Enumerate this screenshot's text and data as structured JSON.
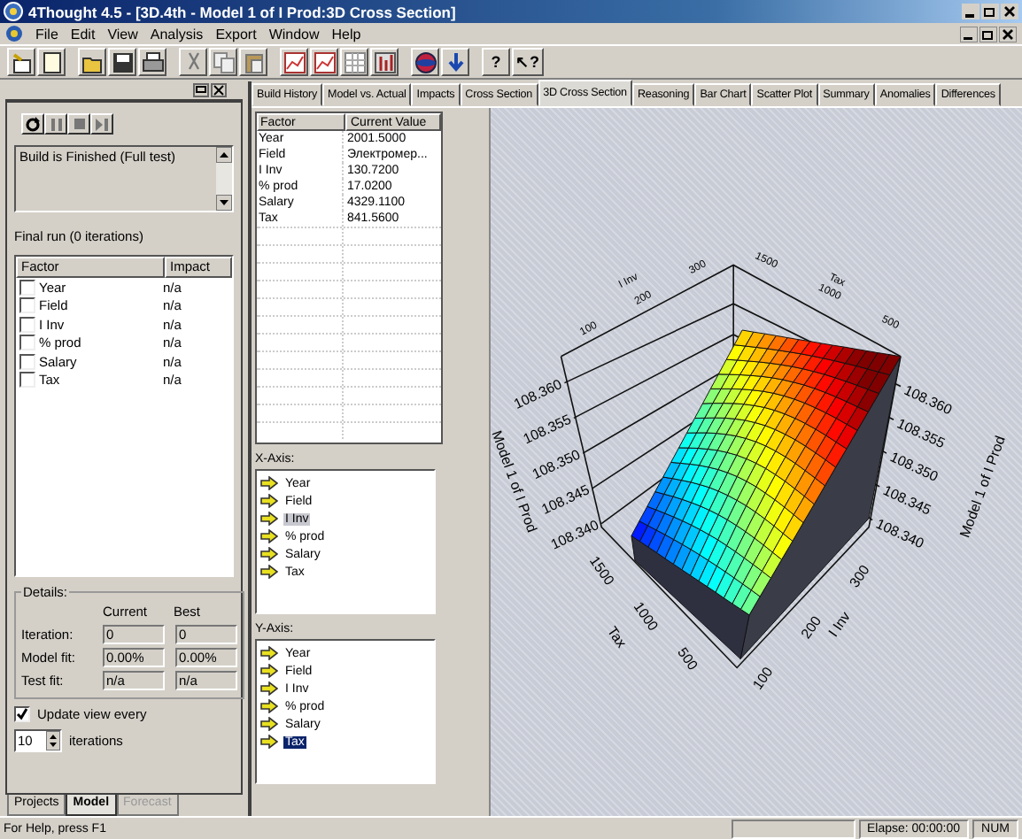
{
  "window": {
    "title": "4Thought 4.5 - [3D.4th - Model 1 of I Prod:3D Cross Section]"
  },
  "menu": [
    "File",
    "Edit",
    "View",
    "Analysis",
    "Export",
    "Window",
    "Help"
  ],
  "toolbar": [
    {
      "kind": "wizard"
    },
    {
      "kind": "new"
    },
    {
      "kind": "open"
    },
    {
      "kind": "save"
    },
    {
      "kind": "print"
    },
    {
      "kind": "cut"
    },
    {
      "kind": "copy"
    },
    {
      "kind": "paste"
    },
    {
      "kind": "chart"
    },
    {
      "kind": "chart"
    },
    {
      "kind": "grid"
    },
    {
      "kind": "table"
    },
    {
      "kind": "globe"
    },
    {
      "kind": "down"
    },
    {
      "kind": "help",
      "glyph": "?"
    },
    {
      "kind": "help",
      "glyph": "↖?"
    }
  ],
  "run_panel": {
    "status_text": "Build is Finished (Full test)",
    "final_run": "Final run (0 iterations)",
    "factor_table": {
      "columns": [
        "Factor",
        "Impact"
      ],
      "rows": [
        {
          "factor": "Year",
          "impact": "n/a",
          "checked": false
        },
        {
          "factor": "Field",
          "impact": "n/a",
          "checked": false
        },
        {
          "factor": "I Inv",
          "impact": "n/a",
          "checked": false
        },
        {
          "factor": "% prod",
          "impact": "n/a",
          "checked": false
        },
        {
          "factor": "Salary",
          "impact": "n/a",
          "checked": false
        },
        {
          "factor": "Tax",
          "impact": "n/a",
          "checked": false
        }
      ]
    },
    "details": {
      "title": "Details:",
      "columns": [
        "Current",
        "Best"
      ],
      "rows": [
        {
          "label": "Iteration:",
          "current": "0",
          "best": "0"
        },
        {
          "label": "Model fit:",
          "current": "0.00%",
          "best": "0.00%"
        },
        {
          "label": "Test fit:",
          "current": "n/a",
          "best": "n/a"
        }
      ]
    },
    "update_view": {
      "label": "Update view every",
      "checked": true
    },
    "iterations": {
      "value": "10",
      "label": "iterations"
    }
  },
  "panel_tabs": [
    {
      "label": "Projects",
      "selected": false,
      "disabled": false
    },
    {
      "label": "Model",
      "selected": true,
      "disabled": false
    },
    {
      "label": "Forecast",
      "selected": false,
      "disabled": true
    }
  ],
  "view_tabs": [
    {
      "label": "Build History",
      "selected": false
    },
    {
      "label": "Model vs. Actual",
      "selected": false
    },
    {
      "label": "Impacts",
      "selected": false
    },
    {
      "label": "Cross Section",
      "selected": false
    },
    {
      "label": "3D Cross Section",
      "selected": true
    },
    {
      "label": "Reasoning",
      "selected": false
    },
    {
      "label": "Bar Chart",
      "selected": false
    },
    {
      "label": "Scatter Plot",
      "selected": false
    },
    {
      "label": "Summary",
      "selected": false
    },
    {
      "label": "Anomalies",
      "selected": false
    },
    {
      "label": "Differences",
      "selected": false
    }
  ],
  "factor_values": {
    "columns": [
      "Factor",
      "Current Value"
    ],
    "rows": [
      [
        "Year",
        "2001.5000"
      ],
      [
        "Field",
        "Электромер..."
      ],
      [
        "I Inv",
        "130.7200"
      ],
      [
        "% prod",
        "17.0200"
      ],
      [
        "Salary",
        "4329.1100"
      ],
      [
        "Tax",
        "841.5600"
      ]
    ]
  },
  "x_axis": {
    "label": "X-Axis:",
    "items": [
      {
        "label": "Year",
        "selected": false
      },
      {
        "label": "Field",
        "selected": false
      },
      {
        "label": "I Inv",
        "selected": true
      },
      {
        "label": "% prod",
        "selected": false
      },
      {
        "label": "Salary",
        "selected": false
      },
      {
        "label": "Tax",
        "selected": false
      }
    ]
  },
  "y_axis": {
    "label": "Y-Axis:",
    "items": [
      {
        "label": "Year",
        "selected": false
      },
      {
        "label": "Field",
        "selected": false
      },
      {
        "label": "I Inv",
        "selected": false
      },
      {
        "label": "% prod",
        "selected": false
      },
      {
        "label": "Salary",
        "selected": false
      },
      {
        "label": "Tax",
        "selected": true
      }
    ]
  },
  "plot": {
    "z_axis_left": {
      "title": "Model 1 of I Prod",
      "ticks": [
        "108.360",
        "108.355",
        "108.350",
        "108.345",
        "108.340"
      ]
    },
    "z_axis_right": {
      "title": "Model 1 of I Prod",
      "ticks": [
        "108.360",
        "108.355",
        "108.350",
        "108.345",
        "108.340"
      ]
    },
    "tax_axis_front": {
      "title": "Tax",
      "ticks": [
        "1500",
        "1000",
        "500"
      ]
    },
    "inv_axis_front": {
      "title": "I Inv",
      "ticks": [
        "100",
        "200",
        "300"
      ]
    },
    "inv_axis_back": {
      "title": "I Inv",
      "ticks": [
        "100",
        "200",
        "300"
      ]
    },
    "tax_axis_back": {
      "title": "Tax",
      "ticks": [
        "1500",
        "1000",
        "500"
      ]
    }
  },
  "status_bar": {
    "help": "For Help, press F1",
    "elapsed": "Elapse: 00:00:00",
    "num": "NUM"
  }
}
